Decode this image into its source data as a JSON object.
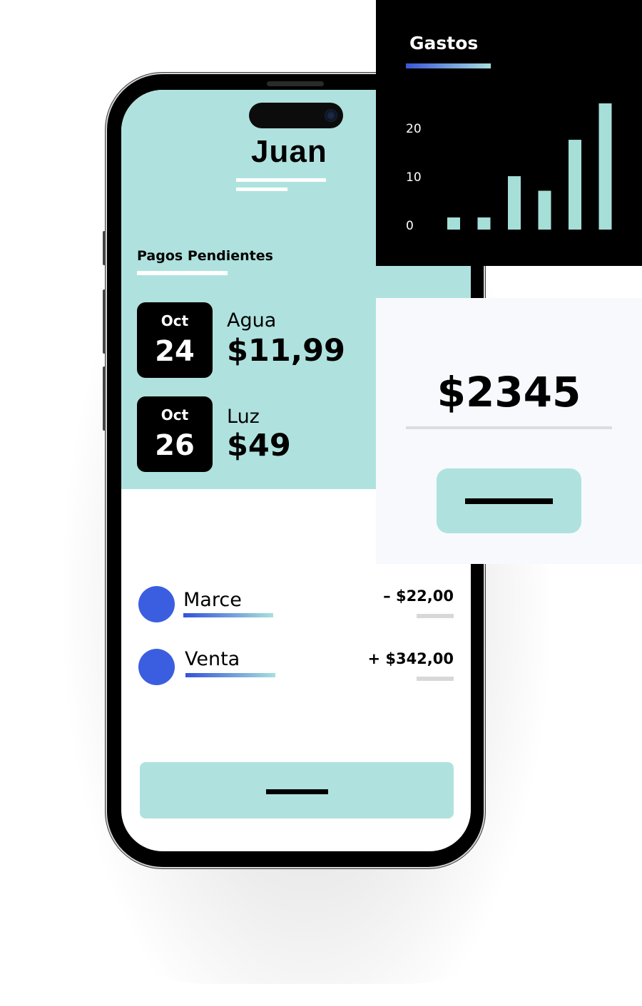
{
  "profile": {
    "name": "Juan"
  },
  "pending_payments": {
    "title": "Pagos Pendientes",
    "items": [
      {
        "month": "Oct",
        "day": "24",
        "label": "Agua",
        "amount": "$11,99"
      },
      {
        "month": "Oct",
        "day": "26",
        "label": "Luz",
        "amount": "$49"
      }
    ]
  },
  "transactions": [
    {
      "name": "Marce",
      "amount": "– $22,00"
    },
    {
      "name": "Venta",
      "amount": "+ $342,00"
    }
  ],
  "balance": {
    "amount": "$2345"
  },
  "chart_data": {
    "type": "bar",
    "title": "Gastos",
    "xlabel": "",
    "ylabel": "",
    "yticks": [
      0,
      10,
      20
    ],
    "ylim": [
      0,
      26
    ],
    "grid": false,
    "categories": [
      "",
      "",
      "",
      "",
      "",
      ""
    ],
    "values": [
      2.5,
      2.5,
      11,
      8,
      18.5,
      26
    ]
  },
  "colors": {
    "teal": "#afe2de",
    "accent_blue": "#3b5ee0",
    "chart_bg": "#000000",
    "chart_bar": "#a6ded8"
  }
}
